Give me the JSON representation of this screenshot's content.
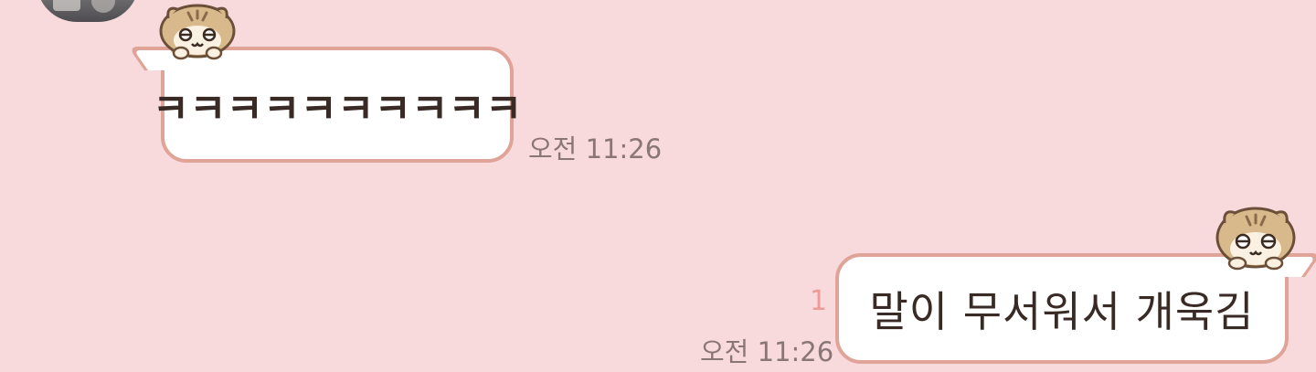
{
  "messages": [
    {
      "direction": "incoming",
      "text": "ㅋㅋㅋㅋㅋㅋㅋㅋㅋㅋ",
      "time": "오전 11:26",
      "sticker": "hamster-icon"
    },
    {
      "direction": "outgoing",
      "text": "말이 무서워서 개욱김",
      "time": "오전 11:26",
      "unread_count": "1",
      "sticker": "hamster-icon"
    }
  ],
  "colors": {
    "background": "#f9dadc",
    "bubble_border": "#e0a398",
    "bubble_fill": "#ffffff",
    "timestamp": "#8a7674",
    "unread": "#ef9a9a"
  }
}
